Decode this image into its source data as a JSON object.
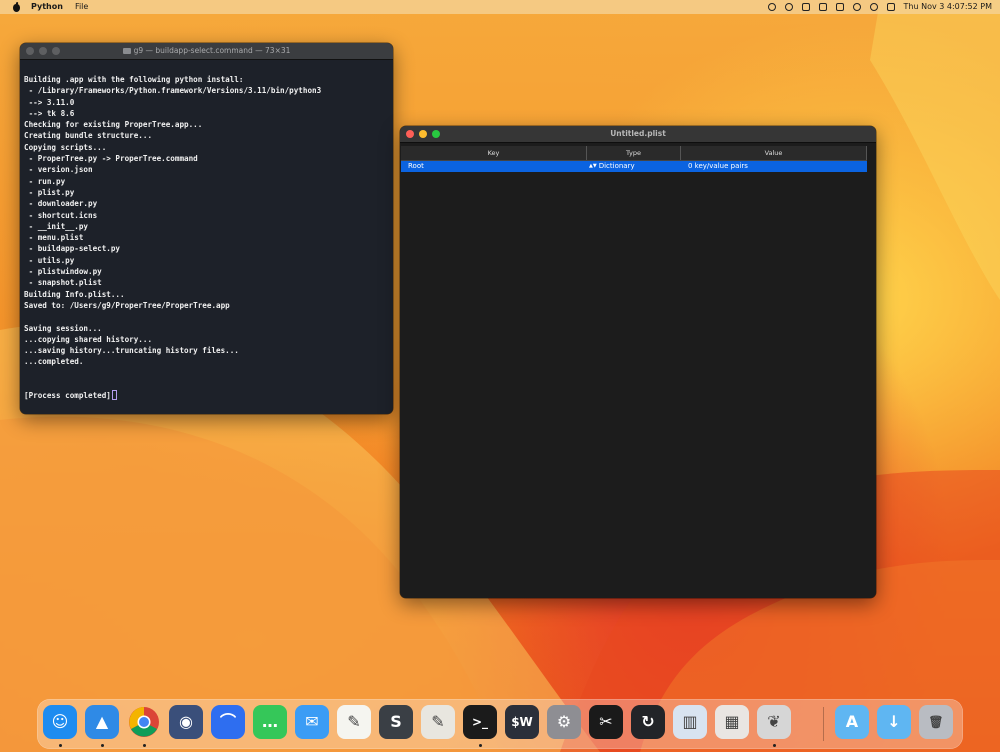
{
  "menubar": {
    "app_name": "Python",
    "menu_file": "File",
    "clock": "Thu Nov 3  4:07:52 PM"
  },
  "terminal": {
    "title": "g9 — buildapp-select.command — 73×31",
    "lines": [
      "Building .app with the following python install:",
      " - /Library/Frameworks/Python.framework/Versions/3.11/bin/python3",
      " --> 3.11.0",
      " --> tk 8.6",
      "Checking for existing ProperTree.app...",
      "Creating bundle structure...",
      "Copying scripts...",
      " - ProperTree.py -> ProperTree.command",
      " - version.json",
      " - run.py",
      " - plist.py",
      " - downloader.py",
      " - shortcut.icns",
      " - __init__.py",
      " - menu.plist",
      " - buildapp-select.py",
      " - utils.py",
      " - plistwindow.py",
      " - snapshot.plist",
      "Building Info.plist...",
      "Saved to: /Users/g9/ProperTree/ProperTree.app",
      "",
      "Saving session...",
      "...copying shared history...",
      "...saving history...truncating history files...",
      "...completed.",
      "",
      "",
      "[Process completed]"
    ]
  },
  "plist": {
    "title": "Untitled.plist",
    "columns": {
      "key": "Key",
      "type": "Type",
      "value": "Value"
    },
    "rows": [
      {
        "key": "Root",
        "type": "Dictionary",
        "value": "0 key/value pairs"
      }
    ]
  },
  "dock": {
    "apps": [
      {
        "name": "finder",
        "icon": "finder-icon",
        "color": "#1e8cf0",
        "glyph": "☺",
        "running": true
      },
      {
        "name": "safari",
        "icon": "safari-icon",
        "color": "#2f8ae6",
        "glyph": "▲",
        "running": true
      },
      {
        "name": "chrome",
        "icon": "chrome-icon",
        "color": "#e9eaec",
        "glyph": "",
        "running": true
      },
      {
        "name": "hardware-monitor",
        "icon": "hardware-monitor-icon",
        "color": "#3a4f7a",
        "glyph": "◉",
        "running": false
      },
      {
        "name": "nordvpn",
        "icon": "nordvpn-icon",
        "color": "#2e6ef0",
        "glyph": "⌒",
        "running": false
      },
      {
        "name": "messages",
        "icon": "messages-icon",
        "color": "#35c759",
        "glyph": "…",
        "running": false
      },
      {
        "name": "mail",
        "icon": "mail-icon",
        "color": "#3b9cf5",
        "glyph": "✉",
        "running": false
      },
      {
        "name": "textedit",
        "icon": "textedit-icon",
        "color": "#f5f5f0",
        "glyph": "✎",
        "running": false
      },
      {
        "name": "sublime-text",
        "icon": "sublime-text-icon",
        "color": "#3a3f45",
        "glyph": "S",
        "running": false
      },
      {
        "name": "script-editor",
        "icon": "script-editor-icon",
        "color": "#e8e6df",
        "glyph": "✎",
        "running": false
      },
      {
        "name": "terminal",
        "icon": "terminal-icon",
        "color": "#1b1b1b",
        "glyph": ">_",
        "running": true
      },
      {
        "name": "wow-script",
        "icon": "dollar-w-icon",
        "color": "#2a2f3a",
        "glyph": "$W",
        "running": false
      },
      {
        "name": "system-preferences",
        "icon": "gear-icon",
        "color": "#8e8e93",
        "glyph": "⚙",
        "running": false
      },
      {
        "name": "pixelmator",
        "icon": "pixelmator-icon",
        "color": "#1a1a1a",
        "glyph": "✂",
        "running": false
      },
      {
        "name": "sync",
        "icon": "sync-icon",
        "color": "#222428",
        "glyph": "↻",
        "running": false
      },
      {
        "name": "parallels",
        "icon": "parallels-icon",
        "color": "#d8e3f0",
        "glyph": "▥",
        "running": false
      },
      {
        "name": "launchpad",
        "icon": "launchpad-icon",
        "color": "#e9e5e2",
        "glyph": "▦",
        "running": false
      },
      {
        "name": "propertree",
        "icon": "propertree-icon",
        "color": "#d6d6d6",
        "glyph": "❦",
        "running": true
      },
      {
        "name": "applications-folder",
        "icon": "applications-folder-icon",
        "color": "#5fb6f2",
        "glyph": "A",
        "running": false
      },
      {
        "name": "downloads-folder",
        "icon": "downloads-folder-icon",
        "color": "#5fb6f2",
        "glyph": "↓",
        "running": false
      },
      {
        "name": "trash",
        "icon": "trash-icon",
        "color": "#b9bcc2",
        "glyph": "🗑",
        "running": false
      }
    ]
  }
}
